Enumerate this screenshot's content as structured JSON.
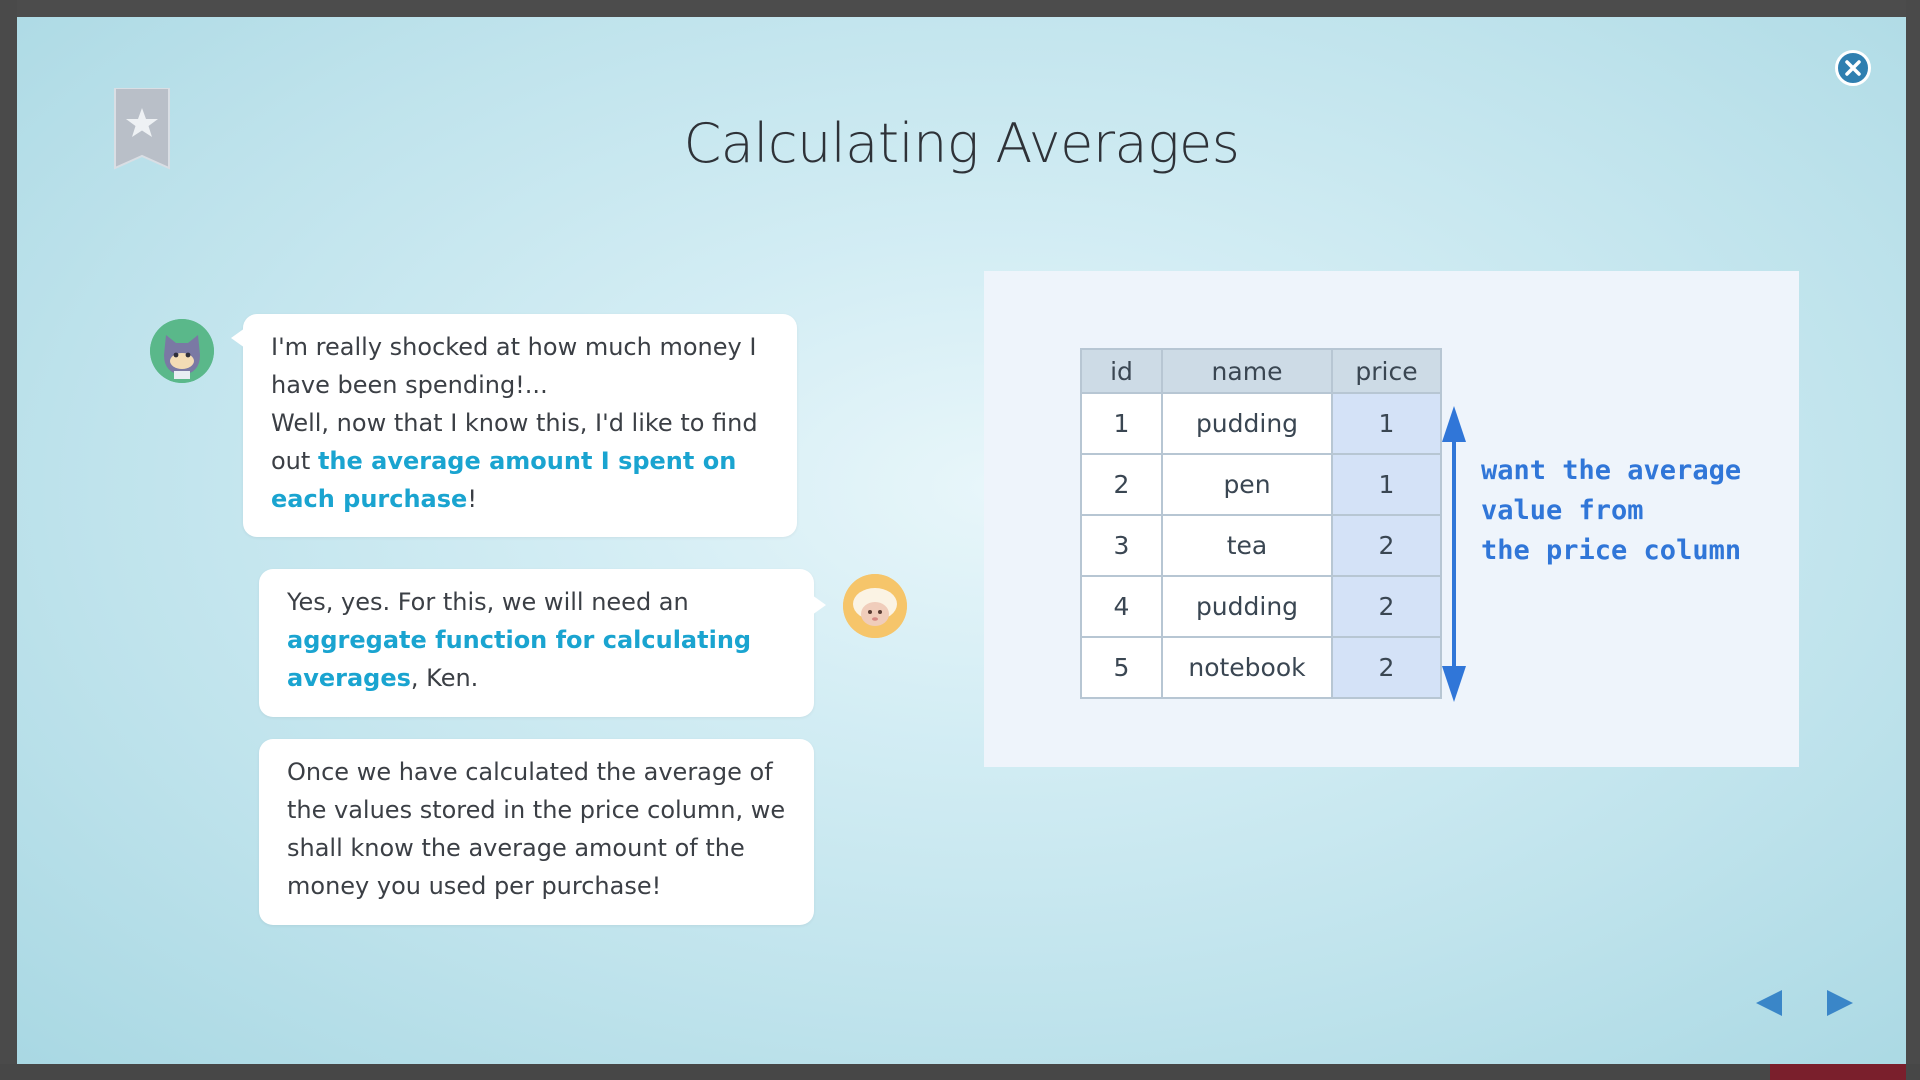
{
  "lesson": {
    "title": "Calculating Averages"
  },
  "icons": {
    "bookmark": "bookmark-star-icon",
    "close": "close-icon",
    "prev": "triangle-left-icon",
    "next": "triangle-right-icon"
  },
  "colors": {
    "highlight": "#1aa4d0",
    "annotation": "#3076d8",
    "close_button": "#2f7fb0",
    "nav_arrow": "#3a86c8"
  },
  "dialogue": [
    {
      "speaker": "Ken",
      "avatar": "cat",
      "lines": {
        "p1": "I'm really shocked at how much money I have been spending!...",
        "p2": "Well, now that I know this, I'd like to find out ",
        "highlight": "the average amount I spent on each purchase",
        "end": "!"
      }
    },
    {
      "speaker": "sheep",
      "avatar": "sheep",
      "lines": {
        "p1": "Yes, yes. For this, we will need an ",
        "highlight": "aggregate function for calculating averages",
        "end": ", Ken."
      }
    },
    {
      "speaker": "sheep",
      "lines": {
        "p1": "Once we have calculated the average of the values stored in the price column, we shall know the average amount of the money you used per purchase!"
      }
    }
  ],
  "table": {
    "headers": [
      "id",
      "name",
      "price"
    ],
    "rows": [
      [
        "1",
        "pudding",
        "1"
      ],
      [
        "2",
        "pen",
        "1"
      ],
      [
        "3",
        "tea",
        "2"
      ],
      [
        "4",
        "pudding",
        "2"
      ],
      [
        "5",
        "notebook",
        "2"
      ]
    ]
  },
  "annotation": {
    "line1": "want the average",
    "line2": "value from",
    "line3": "the price column"
  }
}
